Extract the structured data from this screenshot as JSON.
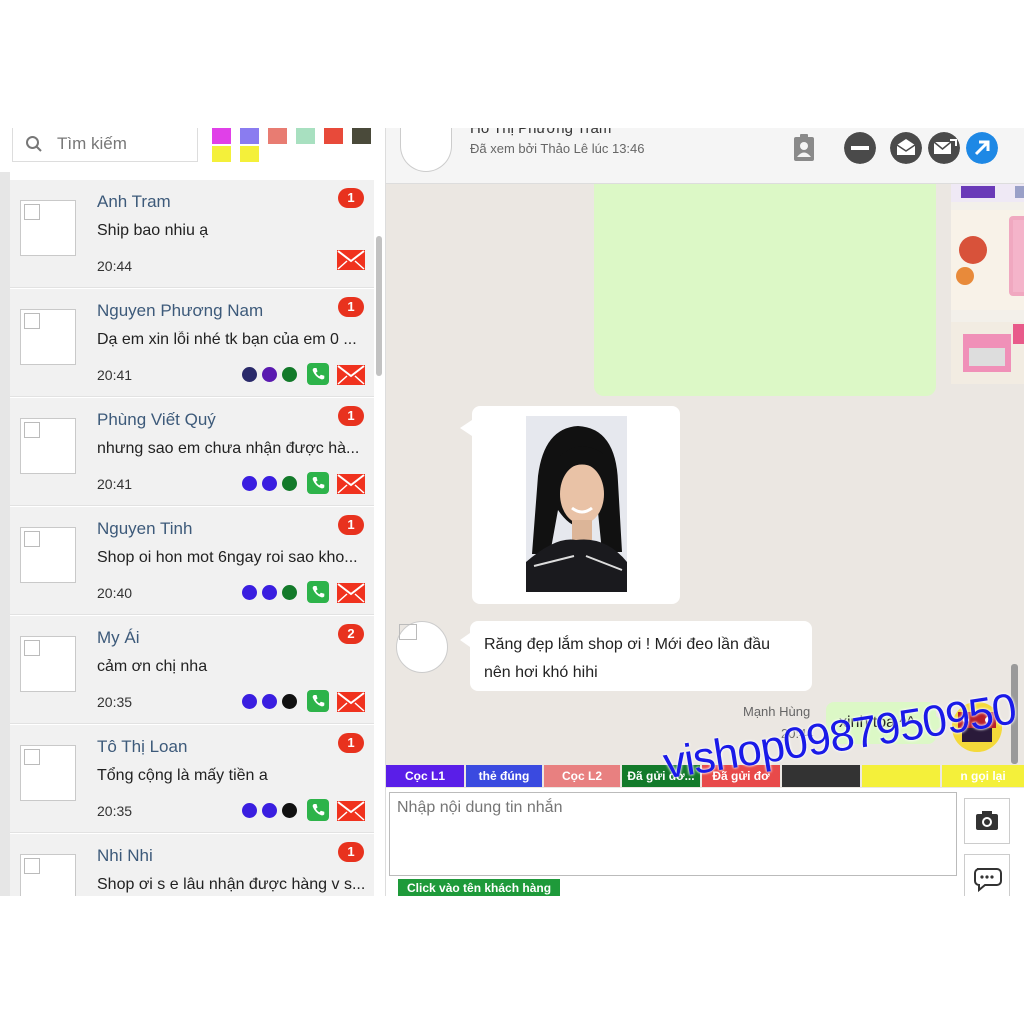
{
  "search": {
    "placeholder": "Tìm kiếm"
  },
  "swatches": [
    "#e040e8",
    "#8a7cf0",
    "#e87c72",
    "#a8e0c0",
    "#e84a3a",
    "#4a4a3a",
    "#f4f03a",
    "#f4f03a"
  ],
  "conversations": [
    {
      "name": "Anh Tram",
      "message": "Ship bao nhiu ạ",
      "time": "20:44",
      "unread": "1",
      "dots": [],
      "phone": false
    },
    {
      "name": "Nguyen Phương Nam",
      "message": "Dạ em xin lỗi nhé tk bạn của em 0 ...",
      "time": "20:41",
      "unread": "1",
      "dots": [
        "#2a2a6a",
        "#5a1ab0",
        "#137a2a"
      ],
      "phone": true
    },
    {
      "name": "Phùng Viết Quý",
      "message": "nhưng sao em chưa nhận được hà...",
      "time": "20:41",
      "unread": "1",
      "dots": [
        "#3a1ee0",
        "#3a1ee0",
        "#137a2a"
      ],
      "phone": true
    },
    {
      "name": "Nguyen Tinh",
      "message": "Shop oi hon mot 6ngay roi sao kho...",
      "time": "20:40",
      "unread": "1",
      "dots": [
        "#3a1ee0",
        "#3a1ee0",
        "#137a2a"
      ],
      "phone": true
    },
    {
      "name": "My Ái",
      "message": "cảm ơn chị nha",
      "time": "20:35",
      "unread": "2",
      "dots": [
        "#3a1ee0",
        "#3a1ee0",
        "#111111"
      ],
      "phone": true
    },
    {
      "name": "Tô Thị Loan",
      "message": "Tổng cộng là mấy tiền a",
      "time": "20:35",
      "unread": "1",
      "dots": [
        "#3a1ee0",
        "#3a1ee0",
        "#111111"
      ],
      "phone": true
    },
    {
      "name": "Nhi Nhi",
      "message": "Shop ơi s e lâu nhận được hàng v s...",
      "time": "",
      "unread": "1",
      "dots": [],
      "phone": false
    }
  ],
  "header": {
    "name": "Hồ Thị Phương Trâm",
    "seen": "Đã xem bởi Thảo Lê lúc 13:46"
  },
  "messages": {
    "incoming_text": "Răng đẹp lắm shop ơi ! Mới đeo lần đầu nên hơi khó hihi",
    "sender": "Mạnh Hùng",
    "sent_time": "20:44",
    "outgoing_text": "xinh tóa ^^"
  },
  "tags": [
    {
      "label": "Cọc L1",
      "color": "#5a1ee8"
    },
    {
      "label": "thẻ đúng",
      "color": "#3a4ae0"
    },
    {
      "label": "Cọc L2",
      "color": "#e88080"
    },
    {
      "label": "Đã gửi đơ...",
      "color": "#137a2a"
    },
    {
      "label": "Đã gửi đơ",
      "color": "#e84a4a"
    },
    {
      "label": "",
      "color": "#333333"
    },
    {
      "label": "",
      "color": "#f4f03a"
    },
    {
      "label": "n gọi lại",
      "color": "#f4f03a"
    }
  ],
  "composer": {
    "placeholder": "Nhập nội dung tin nhắn",
    "hint": "Click vào tên khách hàng"
  },
  "watermark": "vishop0987950950"
}
